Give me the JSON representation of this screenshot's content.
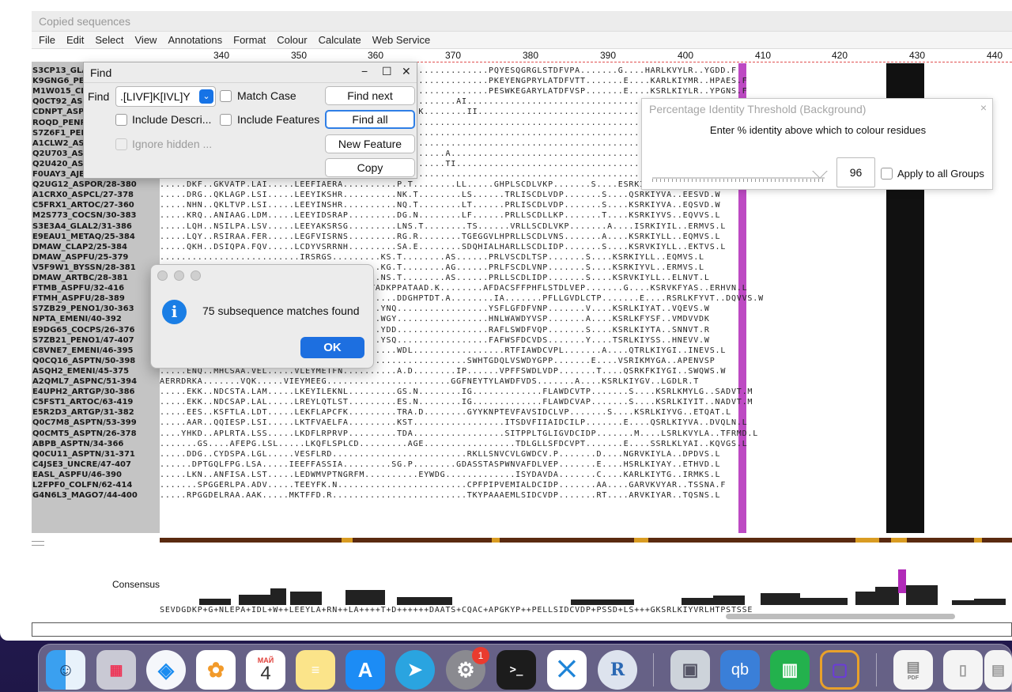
{
  "window": {
    "title": "Copied sequences"
  },
  "menu": [
    "File",
    "Edit",
    "Select",
    "View",
    "Annotations",
    "Format",
    "Colour",
    "Calculate",
    "Web Service"
  ],
  "ruler": {
    "ticks": [
      "340",
      "350",
      "360",
      "370",
      "380",
      "390",
      "400",
      "410",
      "420",
      "430",
      "440"
    ]
  },
  "sequences": [
    {
      "name": "S3CP13_GLA",
      "seq": ".............................................................PQYESQGRGLSTDFVPA.......G....HARLKVYLR..YGDD.F"
    },
    {
      "name": "K9GNG6_PE",
      "seq": ".............................................................PKEYENGPRYLATDFVTT.......E....KARLKIYMR..HPAES.F"
    },
    {
      "name": "M1W015_CL",
      "seq": ".............................................................PESWKEGARYLATDFVSP.......E....KSRLKIYLR..YPGNS.F"
    },
    {
      "name": "Q0CT92_ASI",
      "seq": "............................QE...........QEQG.R........AI.........................................M"
    },
    {
      "name": "CDNPT_ASPI",
      "seq": ".............................................QS.K........II.........................................L"
    },
    {
      "name": "ROQD_PENR",
      "seq": "..........................................................................................................L"
    },
    {
      "name": "S7Z6F1_PEN",
      "seq": "..........................................................................................................W"
    },
    {
      "name": "A1CLW2_AS",
      "seq": "..........................................................................................................F"
    },
    {
      "name": "Q2U703_ASI",
      "seq": "..........................S.............VRA.N........A..........................................L"
    },
    {
      "name": "Q2U420_ASI",
      "seq": "..........................S.............NPA.R........TI.........................................L"
    },
    {
      "name": "F0UAY3_AJEC8/42-394",
      "seq": "....TCDHS..........LEM.......TEKPFKTE..............................................................F"
    },
    {
      "name": "Q2UG12_ASPOR/28-380",
      "seq": ".....DKF..GKVATP.LAI.....LEEFIAERA..........P.T........LL.....GHPLSCDLVKP.......S....ESRKIYCM..EKQLD.L"
    },
    {
      "name": "A1CRX0_ASPCL/27-378",
      "seq": ".....DRG..QKLAGP.LSI.....LEEYIKSHR..........NK.T........LS......TRLISCDLVDP.......S....QSRKIYVA..EESVD.W"
    },
    {
      "name": "C5FRX1_ARTOC/27-360",
      "seq": ".....NHN..QKLTVP.LSI.....LEEYINSHR..........NQ.T........LT......PRLISCDLVDP.......S....KSRKIYVA..EQSVD.W"
    },
    {
      "name": "M2S773_COCSN/30-383",
      "seq": ".....KRQ..ANIAAG.LDM.....LEEYIDSRAP.........DG.N........LF......PRLLSCDLLKP.......T....KSRKIYVS..EQVVS.L"
    },
    {
      "name": "S3E3A4_GLAL2/31-386",
      "seq": ".....LQH..NSILPA.LSV.....LEEYAKSRSG.........LNS.T........TS......VRLLSCDLVKP.......A....ISRKIYIL..ERMVS.L"
    },
    {
      "name": "E9EAU1_METAQ/25-384",
      "seq": ".....LQY..RSIRAA.FER.....LEGFVISRNS.........RG.R........TGEGGVLHPRLLSCDLVNS.......A....KSRKIYLL..EQMVS.L"
    },
    {
      "name": "DMAW_CLAP2/25-384",
      "seq": ".....QKH..DSIQPA.FQV.....LCDYVSRRNH.........SA.E........SDQHIALHARLLSCDLIDP.......S....KSRVKIYLL..EKTVS.L"
    },
    {
      "name": "DMAW_ASPFU/25-379",
      "seq": "..........................IRSRGS.........KS.T........AS......PRLVSCDLTSP.......S....KSRKIYLL..EQMVS.L"
    },
    {
      "name": "V5F9W1_BYSSN/28-381",
      "seq": "..........................IQSLGP.........KG.T........AG......PRLFSCDLVNP.......S....KSRKIYVL..ERMVS.L"
    },
    {
      "name": "DMAW_ARTBC/28-381",
      "seq": "..........................VDSKGP.........NS.T........AS......PRLLSCDLIDP.......S....KSRVKIYLL..ELNVT.L"
    },
    {
      "name": "FTMB_ASPFU/32-416",
      "seq": "..........................IERRRRGLHVPGVTADKPPATAAD.K........AFDACSFFPHFLSTDLVEP.......G....KSRVKFYAS..ERHVN.L"
    },
    {
      "name": "FTMH_ASPFU/28-389",
      "seq": "..........................VHHLRSTLGLQ.......DDGHPTDT.A........IA.......PFLLGVDLCTP.......E....RSRLKFYVT..DQVVS.W"
    },
    {
      "name": "S7ZB29_PENO1/30-363",
      "seq": "..........................MESAGL.........YNQ.................YSFLGFDFVNP.......V....KSRLKIYAT..VQEVS.W"
    },
    {
      "name": "NPTA_EMENI/40-392",
      "seq": "..........................MTELNG.........WGY.................HNLWAWDYVSP.......A....KSRLKFYSF..VMDVVDK"
    },
    {
      "name": "E9DG65_COCPS/26-376",
      "seq": "..........................LKD.KG.........YDD.................RAFLSWDFVQP.......S....KSRLKIYTA..SNNVT.R"
    },
    {
      "name": "S7ZB21_PENO1/47-407",
      "seq": "..........................LEETNG.........YSQ.................FAFWSFDCVDS.......Y....TSRLKIYSS..HNEVV.W"
    },
    {
      "name": "C8VNE7_EMENI/46-395",
      "seq": ".....KDQ..FDCEQA.LEL.....VDEYMEDSGS.........WDL.................RTFIAWDCVPL.......A....QTRLKIYGI..INEVS.L"
    },
    {
      "name": "Q0CQ16_ASPTN/50-398",
      "seq": ".....DSM..VDYSDS.LKL.....VREYTMEG........................SWHTGDQLVSWDYGPP.......E....VSRIKMYGA..APENVSP"
    },
    {
      "name": "ASQH2_EMENI/45-375",
      "seq": ".....ENQ..MHCSAA.VEL.....VLEYMETFN..........A.D........IP......VPFFSWDLVDP.......T....QSRKFKIYGI..SWQWS.W"
    },
    {
      "name": "A2QML7_ASPNC/51-394",
      "seq": "AERRDRKA.......VQK.....VIEYMEEG.......................GGFNEYTYLAWDFVDS.......A....KSRLKIYGV..LGDLR.T"
    },
    {
      "name": "E4UPH2_ARTGP/30-386",
      "seq": ".....EKK..NDCSTA.LAM.....LKEYILEKNL.........GS.N........IG.............FLAWDCVTP.......S....KSRLKMYLG..SADVT.M"
    },
    {
      "name": "C5FST1_ARTOC/63-419",
      "seq": ".....EKK..NDCSAP.LAL.....LREYLQTLST.........ES.N........IG.............FLAWDCVAP.......S....KSRLKIYIT..NADVT.M"
    },
    {
      "name": "E5R2D3_ARTGP/31-382",
      "seq": ".....EES..KSFTLA.LDT.....LEKFLAPCFK.........TRA.D........GYYKNPTEVFAVSIDCLVP.......S....KSRLKIYVG..ETQAT.L"
    },
    {
      "name": "Q0C7M8_ASPTN/53-399",
      "seq": ".....AAR..QQIESP.LSI.....LKTFVAELFA.........KST.................ITSDVFIIAIDCILP.......E....QSRLKIYVA..DVQLN.L"
    },
    {
      "name": "Q0CMT5_ASPTN/26-378",
      "seq": "....YHKD..APLRTA.LSS.....LKDFLRPRVP.........TDA.................SITPPLTGLIGVDCIDP.......M....LSRLKVYLA..TFRMD.L"
    },
    {
      "name": "ABPB_ASPTN/34-366",
      "seq": ".......GS....AFEPG.LSL.....LKQFLSPLCD.........AGE.................TDLGLLSFDCVPT.......E....SSRLKLYAI..KQVGS.L"
    },
    {
      "name": "Q0CU11_ASPTN/31-371",
      "seq": ".....DDG..CYDSPA.LGL.....VESFLRD.........................RKLLSNVCVLGWDCV.P.......D....NGRVKIYLA..DPDVS.L"
    },
    {
      "name": "C4JSE3_UNCRE/47-407",
      "seq": "......DPTGQLFPG.LSA.....IEEFFASSIA.........SG.P........GDASSTASPWNVAFDLVEP.......E....HSRLKIYAY..ETHVD.L"
    },
    {
      "name": "EASL_ASPFU/46-390",
      "seq": ".....LKN..ANFISA.LST.....LEDWMVPTNGRFM..........EYWDG.............ISYDAVDA.......C....KARLKIYTG..IRMKS.L"
    },
    {
      "name": "L2FPF0_COLFN/62-414",
      "seq": ".......SPGGERLPA.ADV.....TEEYFK.N........................CPFPIPVEMIALDCIDP.......AA....GARVKVYAR..TSSNA.F"
    },
    {
      "name": "G4N6L3_MAGO7/44-400",
      "seq": ".....RPGGDELRAA.AAK.....MKTFFD.R.........................TKYPAAAEMLSIDCVDP.......RT....ARVKIYAR..TQSNS.L"
    }
  ],
  "consensus": {
    "label": "Consensus",
    "sequence": "SEVDGDKP+G+NLEPA+IDL+W++LEEYLA+RN++LA++++T+D++++++DAATS+CQAC+APGKYP++PELLSIDCVDP+PSSD+LS+++GKSRLKIYVRLHTPSTSSE"
  },
  "find_dialog": {
    "title": "Find",
    "find_label": "Find",
    "query": ".[LIVF]K[IVL]Y",
    "match_case": "Match Case",
    "include_descriptions": "Include Descri...",
    "include_features": "Include Features",
    "ignore_hidden": "Ignore hidden ...",
    "buttons": {
      "find_next": "Find next",
      "find_all": "Find all",
      "new_feature": "New Feature",
      "copy": "Copy"
    }
  },
  "threshold_dialog": {
    "title": "Percentage Identity Threshold (Background)",
    "message": "Enter % identity above which to colour residues",
    "value": "96",
    "apply_all": "Apply to all Groups"
  },
  "message_dialog": {
    "text": "75 subsequence matches found",
    "ok": "OK",
    "info_glyph": "i"
  },
  "dock": {
    "calendar_month": "МАЙ",
    "calendar_day": "4",
    "settings_badge": "1",
    "qb_label": "qb",
    "r_label": "R",
    "pdf_label": "PDF"
  },
  "colors": {
    "accent": "#1d6fe0",
    "highlight_column": "#b12ab8",
    "motif_block": "#111111"
  }
}
